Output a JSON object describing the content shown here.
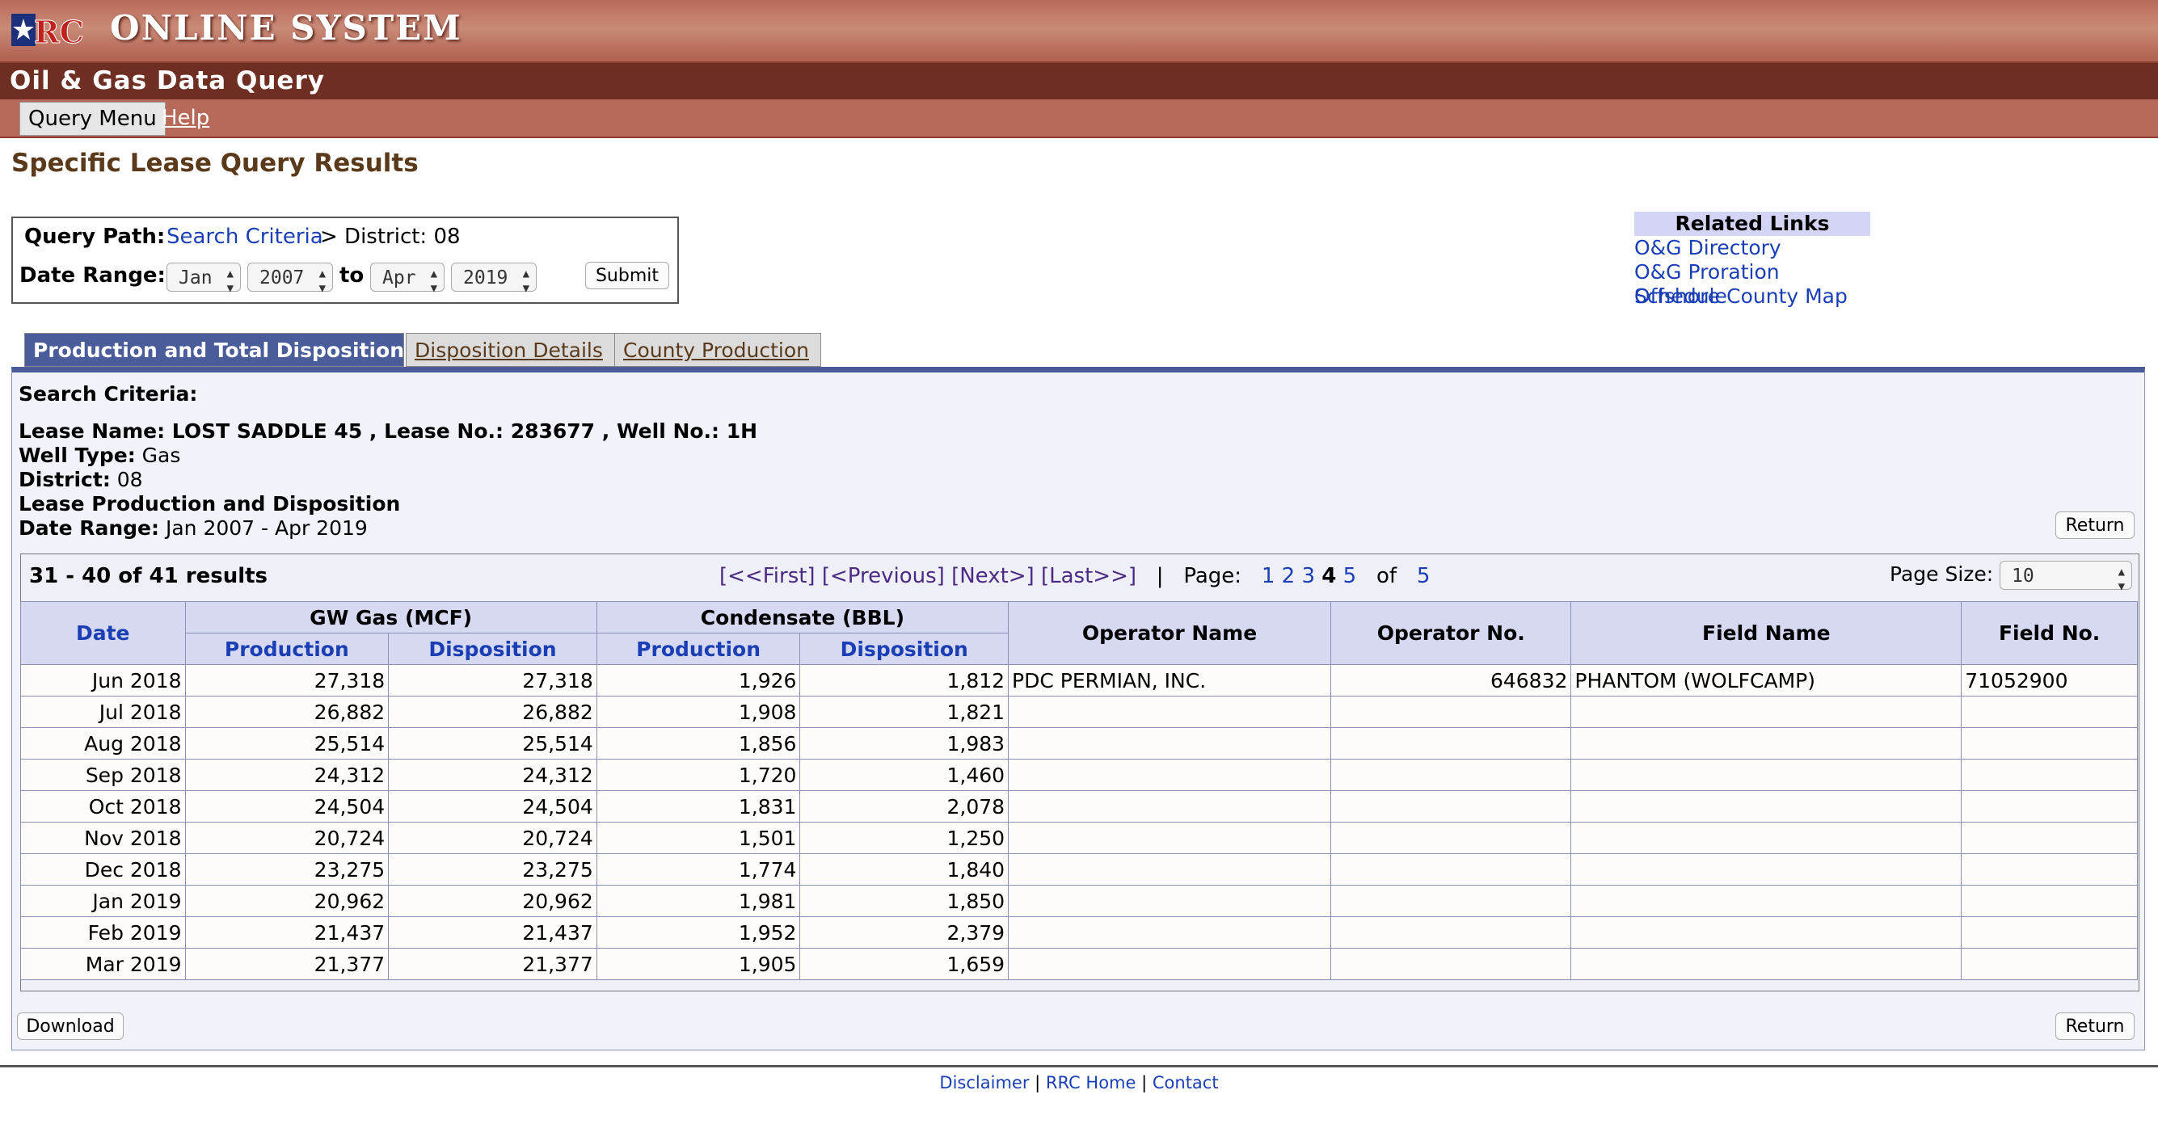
{
  "header": {
    "app_title": "ONLINE SYSTEM",
    "subtitle": "Oil & Gas Data Query",
    "logo_text": "RRC"
  },
  "menu": {
    "query_menu": "Query Menu",
    "help": "Help"
  },
  "page_title": "Specific Lease Query Results",
  "query": {
    "path_label": "Query Path:",
    "path_link": "Search Criteria",
    "path_rest": "> District: 08",
    "date_label": "Date Range:",
    "from_month": "Jan",
    "from_year": "2007",
    "to_text": "to",
    "to_month": "Apr",
    "to_year": "2019",
    "submit": "Submit"
  },
  "related": {
    "heading": "Related Links",
    "links": [
      "O&G Directory",
      "O&G Proration Schedule",
      "Offshore County Map"
    ]
  },
  "tabs": [
    "Production and Total Disposition",
    "Disposition Details",
    "County Production"
  ],
  "criteria": {
    "heading": "Search Criteria:",
    "lease_line": "Lease Name: LOST SADDLE 45 , Lease No.: 283677 , Well No.: 1H",
    "well_type_label": "Well Type:",
    "well_type": "Gas",
    "district_label": "District:",
    "district": "08",
    "prod_heading": "Lease Production and Disposition",
    "date_label": "Date Range:",
    "date_range": "Jan 2007 - Apr 2019",
    "return": "Return"
  },
  "results": {
    "summary": "31 - 40 of 41 results",
    "first": "[<<First]",
    "previous": "[<Previous]",
    "next": "[Next>]",
    "last": "[Last>>]",
    "separator": "|",
    "page_label": "Page:",
    "pages": [
      "1",
      "2",
      "3"
    ],
    "current_page": "4",
    "next_page": "5",
    "of_label": "of",
    "total_pages": "5",
    "page_size_label": "Page Size:",
    "page_size": "10"
  },
  "table": {
    "headers": {
      "date": "Date",
      "gw_gas": "GW Gas (MCF)",
      "condensate": "Condensate (BBL)",
      "production": "Production",
      "disposition": "Disposition",
      "operator_name": "Operator Name",
      "operator_no": "Operator No.",
      "field_name": "Field Name",
      "field_no": "Field No."
    },
    "rows": [
      [
        "Jun 2018",
        "27,318",
        "27,318",
        "1,926",
        "1,812",
        "PDC PERMIAN, INC.",
        "646832",
        "PHANTOM (WOLFCAMP)",
        "71052900"
      ],
      [
        "Jul 2018",
        "26,882",
        "26,882",
        "1,908",
        "1,821",
        "",
        "",
        "",
        ""
      ],
      [
        "Aug 2018",
        "25,514",
        "25,514",
        "1,856",
        "1,983",
        "",
        "",
        "",
        ""
      ],
      [
        "Sep 2018",
        "24,312",
        "24,312",
        "1,720",
        "1,460",
        "",
        "",
        "",
        ""
      ],
      [
        "Oct 2018",
        "24,504",
        "24,504",
        "1,831",
        "2,078",
        "",
        "",
        "",
        ""
      ],
      [
        "Nov 2018",
        "20,724",
        "20,724",
        "1,501",
        "1,250",
        "",
        "",
        "",
        ""
      ],
      [
        "Dec 2018",
        "23,275",
        "23,275",
        "1,774",
        "1,840",
        "",
        "",
        "",
        ""
      ],
      [
        "Jan 2019",
        "20,962",
        "20,962",
        "1,981",
        "1,850",
        "",
        "",
        "",
        ""
      ],
      [
        "Feb 2019",
        "21,437",
        "21,437",
        "1,952",
        "2,379",
        "",
        "",
        "",
        ""
      ],
      [
        "Mar 2019",
        "21,377",
        "21,377",
        "1,905",
        "1,659",
        "",
        "",
        "",
        ""
      ]
    ]
  },
  "actions": {
    "download": "Download",
    "return": "Return"
  },
  "footer": {
    "disclaimer": "Disclaimer",
    "rrc_home": "RRC Home",
    "contact": "Contact",
    "sep": "|"
  }
}
